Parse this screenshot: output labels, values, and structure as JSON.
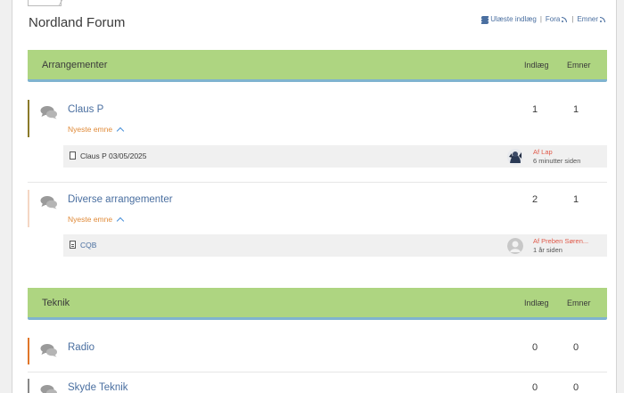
{
  "header": {
    "title": "Nordland Forum",
    "links": {
      "unread": "Ulæste indlæg",
      "sep1": "|",
      "fora": "Fora",
      "sep2": "|",
      "emner": "Emner"
    }
  },
  "colors": {
    "category_header": "#aed581",
    "category_underline": "#7fb3cf",
    "link": "#4a6fa0",
    "newest": "#e08b3a",
    "author": "#e05a4a"
  },
  "categories": [
    {
      "name": "Arrangementer",
      "col_posts": "Indlæg",
      "col_topics": "Emner",
      "forums": [
        {
          "name": "Claus P",
          "posts": "1",
          "topics": "1",
          "bar_color": "#8a7a2a",
          "newest_label": "Nyeste emne",
          "latest": {
            "topic": "Claus P 03/05/2025",
            "by": "Af Lap",
            "when": "6 minutter siden",
            "avatar": "photo"
          }
        },
        {
          "name": "Diverse arrangementer",
          "posts": "2",
          "topics": "1",
          "bar_color": "#f4d6c4",
          "newest_label": "Nyeste emne",
          "latest": {
            "topic": "CQB",
            "by": "Af Preben Søren...",
            "when": "1 år siden",
            "avatar": "default"
          }
        }
      ]
    },
    {
      "name": "Teknik",
      "col_posts": "Indlæg",
      "col_topics": "Emner",
      "forums": [
        {
          "name": "Radio",
          "posts": "0",
          "topics": "0",
          "bar_color": "#e0762a"
        },
        {
          "name": "Skyde Teknik",
          "posts": "0",
          "topics": "0",
          "bar_color": "#888888"
        }
      ]
    }
  ]
}
